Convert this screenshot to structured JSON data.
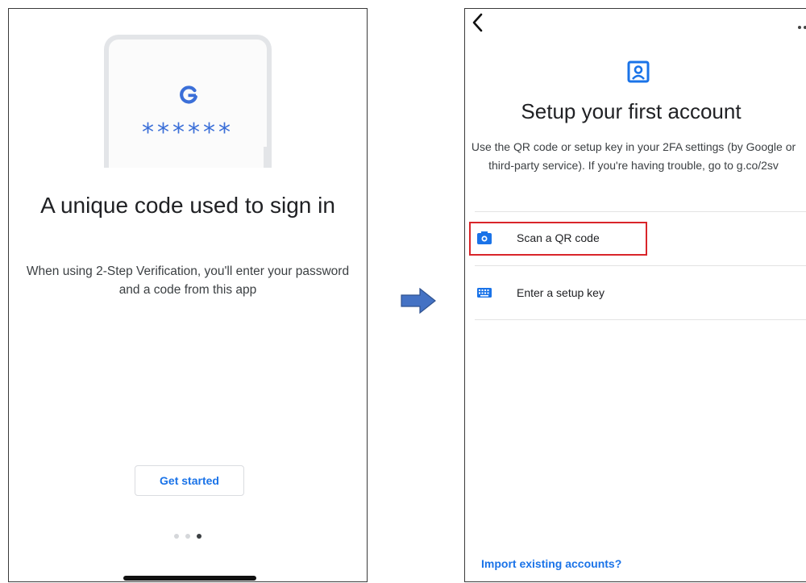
{
  "left_screen": {
    "code_mask": "******",
    "title": "A unique code used to sign in",
    "description": "When using 2-Step Verification, you'll enter your password and a code from this app",
    "get_started_label": "Get started",
    "pagination": {
      "total": 3,
      "active_index": 3
    }
  },
  "right_screen": {
    "title": "Setup your first account",
    "description": "Use the QR code or setup key in your 2FA settings (by Google or third-party service). If you're having trouble, go to g.co/2sv",
    "options": [
      {
        "label": "Scan a QR code",
        "icon": "camera-icon"
      },
      {
        "label": "Enter a setup key",
        "icon": "keyboard-icon"
      }
    ],
    "import_link": "Import existing accounts?"
  },
  "colors": {
    "accent": "#1a73e8",
    "highlight": "#d9252a",
    "arrow": "#4472c4"
  }
}
